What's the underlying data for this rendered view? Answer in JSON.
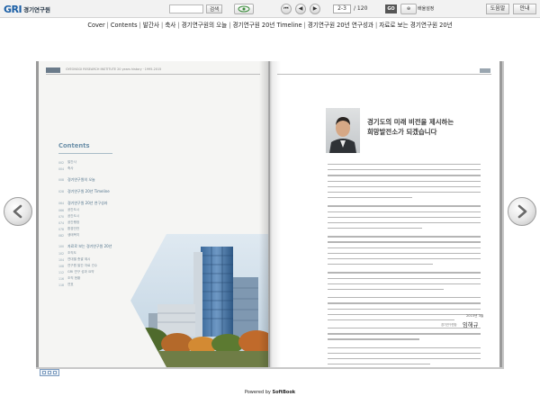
{
  "app": {
    "logo_mark": "GRI",
    "logo_name": "경기연구원"
  },
  "toolbar": {
    "search_placeholder": "",
    "search_button": "검색",
    "current_page": "2-3",
    "total_pages": "/ 120",
    "go_label": "GO",
    "zoom_text": "배율설정",
    "help_label": "도움말",
    "info_label": "안내"
  },
  "menu": {
    "items": [
      "Cover",
      "Contents",
      "발간사",
      "축사",
      "경기연구원의 오늘",
      "경기연구원 20년 Timeline",
      "경기연구원 20년 연구성과",
      "자료로 보는 경기연구원 20년"
    ]
  },
  "left_page": {
    "header_text": "GYEONGGI RESEARCH INSTITUTE 20 years history · 1995-2015",
    "toc_title": "Contents",
    "toc": [
      {
        "num": "002",
        "label": "발간사",
        "major": false
      },
      {
        "num": "004",
        "label": "축사",
        "major": false
      },
      {
        "num": "008",
        "label": "경기연구원의 오늘",
        "major": true
      },
      {
        "num": "028",
        "label": "경기연구원 20년 Timeline",
        "major": true
      },
      {
        "num": "064",
        "label": "경기연구원 20년 연구성과",
        "major": true
      },
      {
        "num": "066",
        "label": "공간도시",
        "major": false
      },
      {
        "num": "070",
        "label": "공간도시",
        "major": false
      },
      {
        "num": "074",
        "label": "공간행정",
        "major": false
      },
      {
        "num": "078",
        "label": "환경안전",
        "major": false
      },
      {
        "num": "082",
        "label": "생태복지",
        "major": false
      },
      {
        "num": "100",
        "label": "자료로 보는 경기연구원 20년",
        "major": true
      },
      {
        "num": "102",
        "label": "조직도",
        "major": false
      },
      {
        "num": "104",
        "label": "연대별 총괄 제시",
        "major": false
      },
      {
        "num": "108",
        "label": "연구원 발간 자료 건수",
        "major": false
      },
      {
        "num": "112",
        "label": "GRI 연구 성과 요약",
        "major": false
      },
      {
        "num": "116",
        "label": "조직 현황",
        "major": false
      },
      {
        "num": "118",
        "label": "연표",
        "major": false
      }
    ]
  },
  "right_page": {
    "headline_1": "경기도의 미래 비전을 제시하는",
    "headline_2": "희망발전소가 되겠습니다",
    "date": "2015년 3월",
    "role": "경기연구원장",
    "name": "임해규"
  },
  "footer": {
    "powered_prefix": "Powered by",
    "powered_brand": "SoftBook"
  },
  "colors": {
    "logo_blue": "#1b5fa6",
    "logo_green": "#7db33a",
    "toc_accent": "#6b8fa8",
    "building_glass": "#4a76a8"
  },
  "icons": {
    "prev_page": "arrow-left-icon",
    "next_page": "arrow-right-icon",
    "first_page": "first-page-icon",
    "last_page": "last-page-icon",
    "view_mode": "view-mode-icon"
  }
}
